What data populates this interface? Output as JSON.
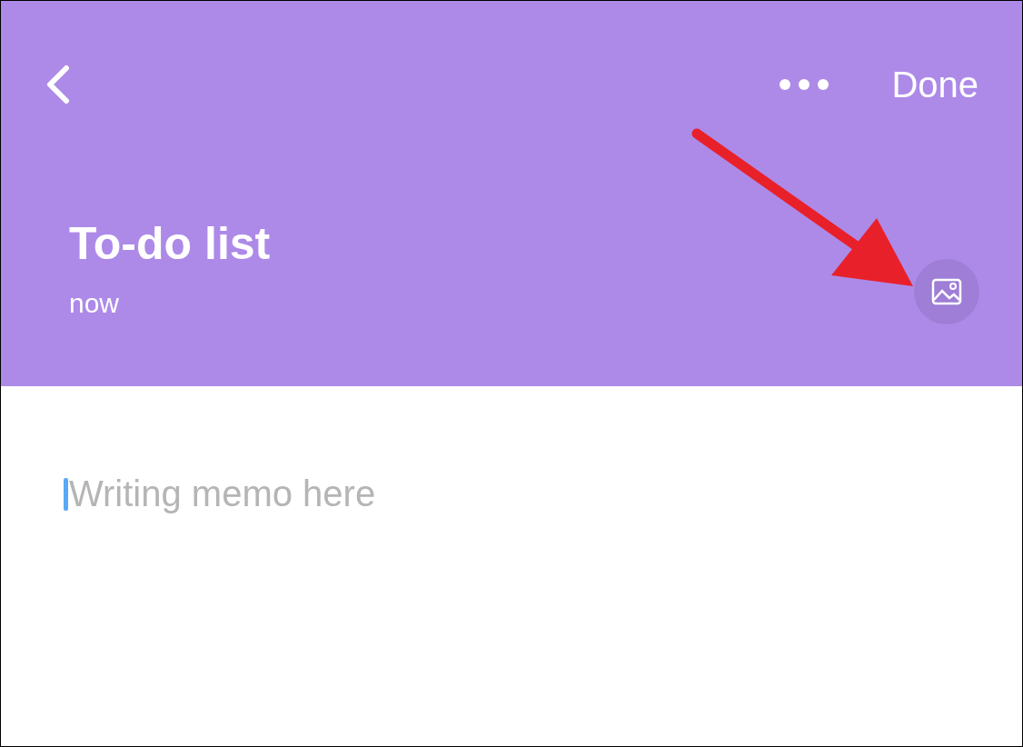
{
  "header": {
    "done_label": "Done",
    "title": "To-do list",
    "timestamp": "now"
  },
  "editor": {
    "placeholder": "Writing memo here",
    "focused": true
  }
}
